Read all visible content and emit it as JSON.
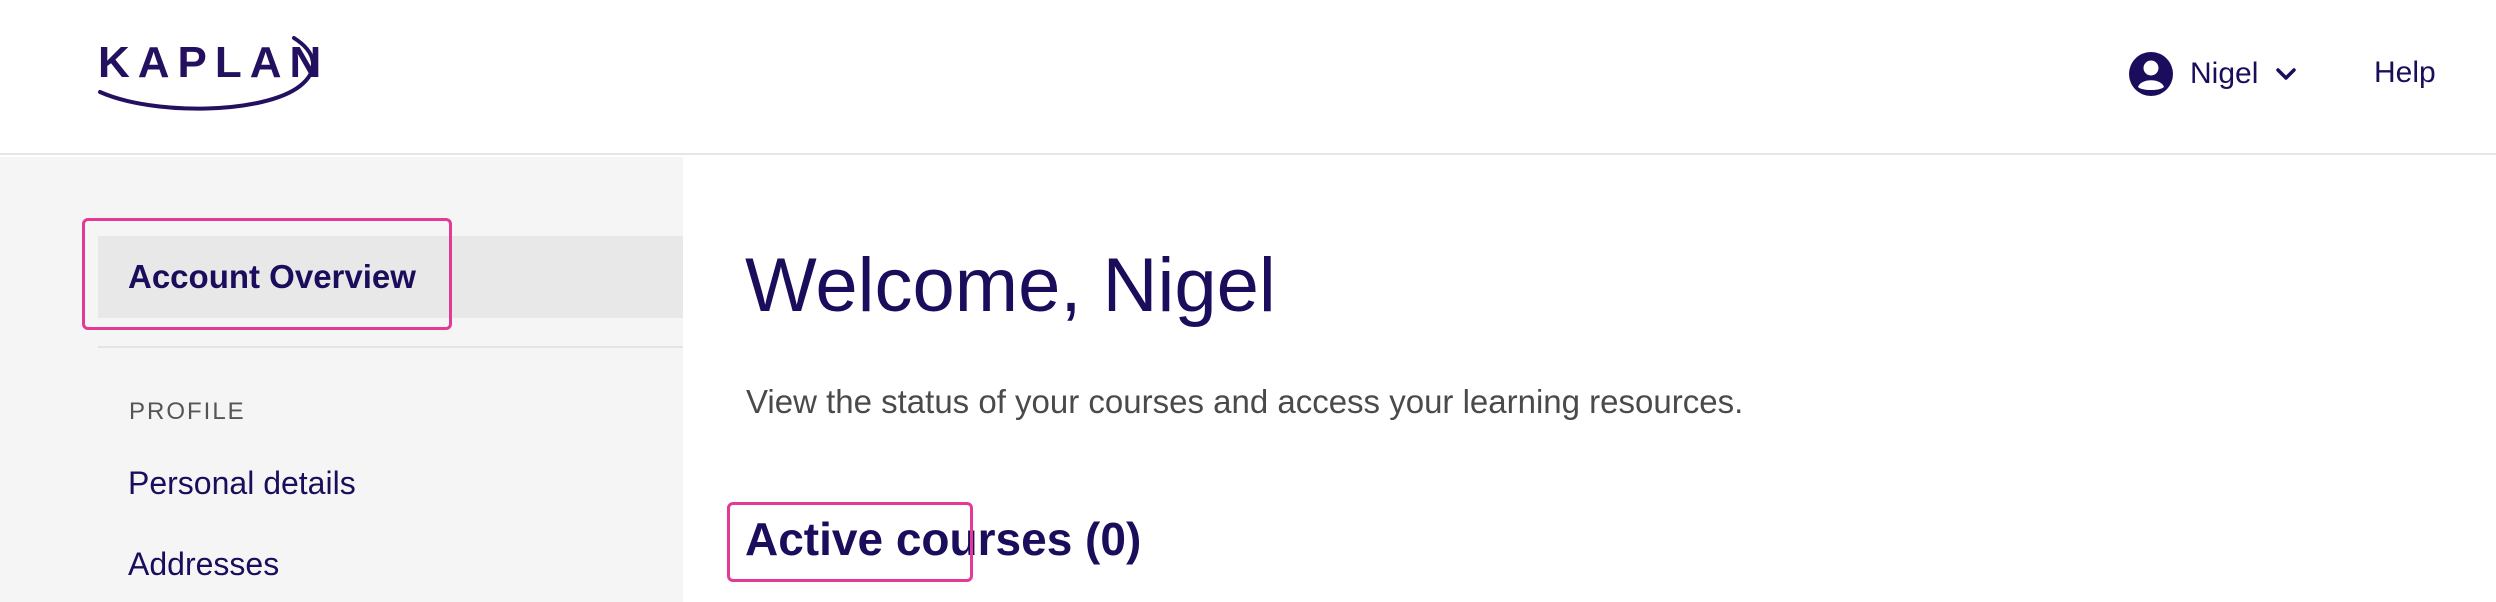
{
  "header": {
    "logo_text": "KAPLAN",
    "user_name": "Nigel",
    "help_label": "Help"
  },
  "sidebar": {
    "active_item": "Account Overview",
    "section_label": "PROFILE",
    "items": [
      {
        "label": "Personal details"
      },
      {
        "label": "Addresses"
      }
    ]
  },
  "main": {
    "title": "Welcome, Nigel",
    "subtitle": "View the status of your courses and access your learning resources.",
    "active_courses_heading": "Active courses (0)"
  },
  "colors": {
    "brand": "#1c0d5c",
    "highlight": "#e23a96",
    "sidebar_bg": "#f5f5f5"
  },
  "icons": [
    "kaplan-logo",
    "user-avatar-icon",
    "chevron-down-icon"
  ]
}
